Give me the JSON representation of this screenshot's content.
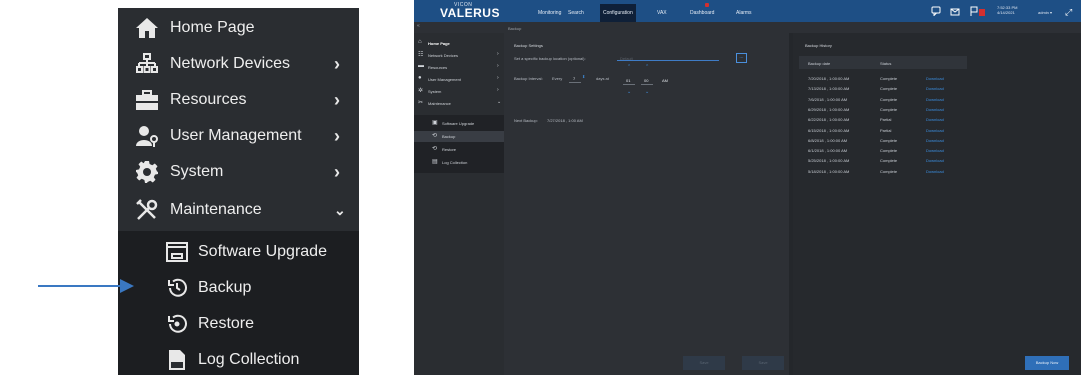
{
  "zoom_menu": {
    "items": [
      {
        "label": "Home Page",
        "icon": "home-icon",
        "has_chevron": false
      },
      {
        "label": "Network Devices",
        "icon": "network-icon",
        "has_chevron": true
      },
      {
        "label": "Resources",
        "icon": "toolbox-icon",
        "has_chevron": true
      },
      {
        "label": "User Management",
        "icon": "user-key-icon",
        "has_chevron": true
      },
      {
        "label": "System",
        "icon": "gear-icon",
        "has_chevron": true
      },
      {
        "label": "Maintenance",
        "icon": "tools-icon",
        "has_chevron": true
      }
    ],
    "sub_items": [
      {
        "label": "Software Upgrade",
        "icon": "upgrade-icon"
      },
      {
        "label": "Backup",
        "icon": "backup-icon"
      },
      {
        "label": "Restore",
        "icon": "restore-icon"
      },
      {
        "label": "Log Collection",
        "icon": "log-icon"
      }
    ]
  },
  "app": {
    "brand_top": "VICON",
    "brand": "VALERUS",
    "nav": [
      "Monitoring",
      "Search",
      "Configuration",
      "VAX",
      "Dashboard",
      "Alarms"
    ],
    "active_nav": "Configuration",
    "clock_time": "7:52:33 PM",
    "clock_date": "4/14/2021",
    "user": "admin",
    "user_caret": "▾",
    "collapse": "«",
    "breadcrumb": "Backup",
    "sidebar": {
      "items": [
        "Home Page",
        "Network Devices",
        "Resources",
        "User Management",
        "System",
        "Maintenance"
      ],
      "sub_items": [
        "Software Upgrade",
        "Backup",
        "Restore",
        "Log Collection"
      ],
      "selected": "Backup"
    },
    "settings": {
      "title": "Backup Settings",
      "location_label": "Set a specific backup location (optional):",
      "location_placeholder": "Default",
      "browse_label": "...",
      "interval_label": "Backup Interval:",
      "every_label": "Every",
      "days_value": "7",
      "days_at_label": "days at",
      "hour_value": "01",
      "minute_value": "00",
      "ampm_value": "AM",
      "next_backup_label": "Next Backup:",
      "next_backup_value": "7/27/2018 , 1:00 AM",
      "save_label": "Save",
      "cancel_label": "Save"
    },
    "history": {
      "title": "Backup History",
      "col_date": "Backup date",
      "col_status": "Status",
      "rows": [
        {
          "date": "7/20/2018 , 1:00:00 AM",
          "status": "Complete",
          "link": "Download"
        },
        {
          "date": "7/13/2018 , 1:00:00 AM",
          "status": "Complete",
          "link": "Download"
        },
        {
          "date": "7/6/2018 , 1:00:00 AM",
          "status": "Complete",
          "link": "Download"
        },
        {
          "date": "6/29/2018 , 1:00:00 AM",
          "status": "Complete",
          "link": "Download"
        },
        {
          "date": "6/22/2018 , 1:00:00 AM",
          "status": "Partial",
          "link": "Download"
        },
        {
          "date": "6/15/2018 , 1:00:00 AM",
          "status": "Partial",
          "link": "Download"
        },
        {
          "date": "6/8/2018 , 1:00:00 AM",
          "status": "Complete",
          "link": "Download"
        },
        {
          "date": "6/1/2018 , 1:00:00 AM",
          "status": "Complete",
          "link": "Download"
        },
        {
          "date": "5/25/2018 , 1:00:00 AM",
          "status": "Complete",
          "link": "Download"
        },
        {
          "date": "5/18/2018 , 1:00:00 AM",
          "status": "Complete",
          "link": "Download"
        }
      ],
      "backup_now_label": "Backup Now"
    }
  },
  "colors": {
    "topbar": "#1e4f85",
    "accent": "#3b8ee0",
    "arrow": "#3a78c2",
    "panel": "#2a2d31"
  }
}
